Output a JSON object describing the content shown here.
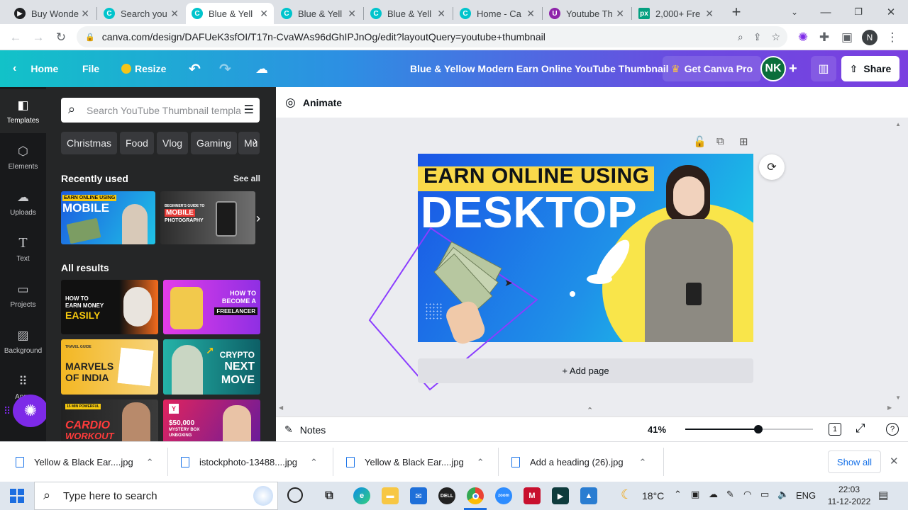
{
  "browser": {
    "tabs": [
      {
        "title": "Buy Wonde",
        "favicon_color": "#202124",
        "active": false
      },
      {
        "title": "Search you",
        "favicon_color": "#00c4cc",
        "active": false
      },
      {
        "title": "Blue & Yell",
        "favicon_color": "#00c4cc",
        "active": true
      },
      {
        "title": "Blue & Yell",
        "favicon_color": "#00c4cc",
        "active": false
      },
      {
        "title": "Blue & Yell",
        "favicon_color": "#00c4cc",
        "active": false
      },
      {
        "title": "Home - Ca",
        "favicon_color": "#00c4cc",
        "active": false
      },
      {
        "title": "Youtube Th",
        "favicon_color": "#8e24aa",
        "active": false
      },
      {
        "title": "2,000+ Fre",
        "favicon_color": "#05a081",
        "active": false
      }
    ],
    "url": "canva.com/design/DAFUeK3sfOI/T17n-CvaWAs96dGhIPJnOg/edit?layoutQuery=youtube+thumbnail",
    "profile_initial": "N"
  },
  "canva_header": {
    "home": "Home",
    "file": "File",
    "resize": "Resize",
    "design_title": "Blue & Yellow Modern Earn Online YouTube Thumbnail",
    "get_pro": "Get Canva Pro",
    "avatar_initials": "NK",
    "share": "Share"
  },
  "rail": [
    {
      "label": "Templates",
      "icon": "templates-icon"
    },
    {
      "label": "Elements",
      "icon": "elements-icon"
    },
    {
      "label": "Uploads",
      "icon": "uploads-icon"
    },
    {
      "label": "Text",
      "icon": "text-icon"
    },
    {
      "label": "Projects",
      "icon": "projects-icon"
    },
    {
      "label": "Background",
      "icon": "background-icon"
    },
    {
      "label": "Apps",
      "icon": "apps-icon"
    }
  ],
  "panel": {
    "search_placeholder": "Search YouTube Thumbnail templa",
    "chips": [
      "Christmas",
      "Food",
      "Vlog",
      "Gaming",
      "Mu"
    ],
    "recently_used": "Recently used",
    "see_all": "See all",
    "all_results": "All results",
    "recent_thumbs": [
      {
        "line1": "EARN ONLINE USING",
        "line2": "MOBILE"
      },
      {
        "line1": "BEGINNER'S GUIDE TO",
        "line2": "MOBILE",
        "line3": "PHOTOGRAPHY"
      }
    ],
    "results": [
      {
        "text": [
          "HOW TO",
          "EARN MONEY",
          "EASILY"
        ]
      },
      {
        "text": [
          "HOW TO",
          "BECOME A",
          "FREELANCER"
        ]
      },
      {
        "text": [
          "TRAVEL GUIDE",
          "MARVELS",
          "OF INDIA"
        ]
      },
      {
        "text": [
          "CRYPTO",
          "NEXT",
          "MOVE"
        ]
      },
      {
        "text": [
          "15 MIN POWERFUL",
          "CARDIO",
          "WORKOUT"
        ]
      },
      {
        "text": [
          "$50,000",
          "MYSTERY BOX",
          "UNBOXING"
        ]
      }
    ]
  },
  "editor": {
    "animate": "Animate",
    "canvas_line1": "EARN ONLINE USING",
    "canvas_line2": "DESKTOP",
    "add_page": "+ Add page",
    "notes": "Notes",
    "zoom": "41%",
    "zoom_fraction": 0.41,
    "page_count": "1"
  },
  "downloads": [
    {
      "name": "Yellow & Black Ear....jpg"
    },
    {
      "name": "istockphoto-13488....jpg"
    },
    {
      "name": "Yellow & Black Ear....jpg"
    },
    {
      "name": "Add a heading (26).jpg"
    }
  ],
  "downloads_show_all": "Show all",
  "taskbar": {
    "search_placeholder": "Type here to search",
    "temperature": "18°C",
    "language": "ENG",
    "time": "22:03",
    "date": "11-12-2022"
  }
}
